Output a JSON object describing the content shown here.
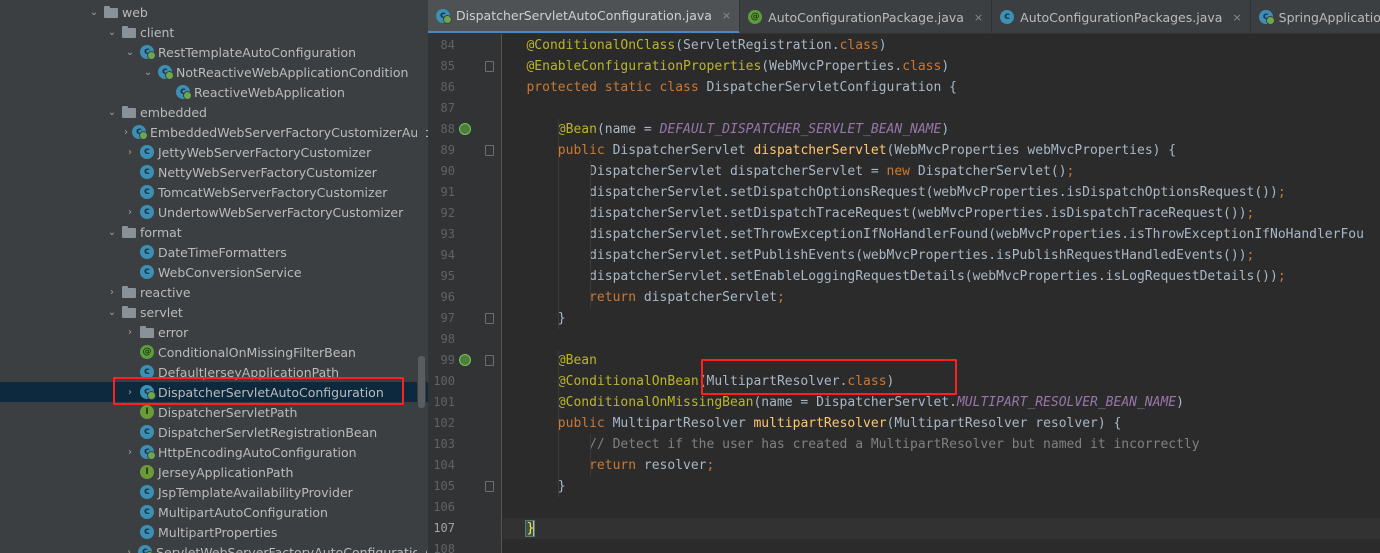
{
  "project_tree": {
    "items": [
      {
        "depth": 5,
        "expander": "open",
        "icon": "folder",
        "label": "web"
      },
      {
        "depth": 6,
        "expander": "open",
        "icon": "folder",
        "label": "client"
      },
      {
        "depth": 7,
        "expander": "open",
        "icon": "class-spring",
        "label": "RestTemplateAutoConfiguration"
      },
      {
        "depth": 8,
        "expander": "open",
        "icon": "class-spring",
        "label": "NotReactiveWebApplicationCondition"
      },
      {
        "depth": 9,
        "expander": "none",
        "icon": "class-spring",
        "label": "ReactiveWebApplication"
      },
      {
        "depth": 6,
        "expander": "open",
        "icon": "folder",
        "label": "embedded"
      },
      {
        "depth": 7,
        "expander": "closed",
        "icon": "class-spring",
        "label": "EmbeddedWebServerFactoryCustomizerAutoC"
      },
      {
        "depth": 7,
        "expander": "closed",
        "icon": "class",
        "label": "JettyWebServerFactoryCustomizer"
      },
      {
        "depth": 7,
        "expander": "none",
        "icon": "class",
        "label": "NettyWebServerFactoryCustomizer"
      },
      {
        "depth": 7,
        "expander": "none",
        "icon": "class",
        "label": "TomcatWebServerFactoryCustomizer"
      },
      {
        "depth": 7,
        "expander": "closed",
        "icon": "class",
        "label": "UndertowWebServerFactoryCustomizer"
      },
      {
        "depth": 6,
        "expander": "open",
        "icon": "folder",
        "label": "format"
      },
      {
        "depth": 7,
        "expander": "none",
        "icon": "class",
        "label": "DateTimeFormatters"
      },
      {
        "depth": 7,
        "expander": "none",
        "icon": "class",
        "label": "WebConversionService"
      },
      {
        "depth": 6,
        "expander": "closed",
        "icon": "folder",
        "label": "reactive"
      },
      {
        "depth": 6,
        "expander": "open",
        "icon": "folder",
        "label": "servlet"
      },
      {
        "depth": 7,
        "expander": "closed",
        "icon": "folder",
        "label": "error"
      },
      {
        "depth": 7,
        "expander": "none",
        "icon": "annotation",
        "label": "ConditionalOnMissingFilterBean"
      },
      {
        "depth": 7,
        "expander": "none",
        "icon": "class",
        "label": "DefaultJerseyApplicationPath"
      },
      {
        "depth": 7,
        "expander": "closed",
        "icon": "class-spring",
        "label": "DispatcherServletAutoConfiguration",
        "selected": true
      },
      {
        "depth": 7,
        "expander": "none",
        "icon": "interface",
        "label": "DispatcherServletPath"
      },
      {
        "depth": 7,
        "expander": "none",
        "icon": "class",
        "label": "DispatcherServletRegistrationBean"
      },
      {
        "depth": 7,
        "expander": "closed",
        "icon": "class-spring",
        "label": "HttpEncodingAutoConfiguration"
      },
      {
        "depth": 7,
        "expander": "none",
        "icon": "interface",
        "label": "JerseyApplicationPath"
      },
      {
        "depth": 7,
        "expander": "none",
        "icon": "class",
        "label": "JspTemplateAvailabilityProvider"
      },
      {
        "depth": 7,
        "expander": "none",
        "icon": "class",
        "label": "MultipartAutoConfiguration"
      },
      {
        "depth": 7,
        "expander": "none",
        "icon": "class",
        "label": "MultipartProperties"
      },
      {
        "depth": 7,
        "expander": "closed",
        "icon": "class-spring",
        "label": "ServletWebServerFactoryAutoConfiguration"
      }
    ]
  },
  "tabs": [
    {
      "label": "DispatcherServletAutoConfiguration.java",
      "icon": "class-spring",
      "active": true,
      "close": "×"
    },
    {
      "label": "AutoConfigurationPackage.java",
      "icon": "annotation",
      "active": false,
      "close": "×"
    },
    {
      "label": "AutoConfigurationPackages.java",
      "icon": "class",
      "active": false,
      "close": "×"
    },
    {
      "label": "SpringApplication.class",
      "icon": "class-spring",
      "active": false,
      "close": "×"
    }
  ],
  "editor": {
    "lines": [
      {
        "n": "84",
        "mark": false,
        "fold": false,
        "indent": 1,
        "tokens": [
          [
            "ann",
            "@ConditionalOnClass"
          ],
          [
            "p",
            "(ServletRegistration."
          ],
          [
            "kw",
            "class"
          ],
          [
            "p",
            ")"
          ]
        ]
      },
      {
        "n": "85",
        "mark": false,
        "fold": true,
        "indent": 1,
        "tokens": [
          [
            "ann",
            "@EnableConfigurationProperties"
          ],
          [
            "p",
            "(WebMvcProperties."
          ],
          [
            "kw",
            "class"
          ],
          [
            "p",
            ")"
          ]
        ]
      },
      {
        "n": "86",
        "mark": false,
        "fold": false,
        "indent": 1,
        "tokens": [
          [
            "kw",
            "protected static class "
          ],
          [
            "p",
            "DispatcherServletConfiguration "
          ],
          [
            "brace",
            "{"
          ]
        ]
      },
      {
        "n": "87",
        "mark": false,
        "fold": false,
        "indent": 0,
        "tokens": []
      },
      {
        "n": "88",
        "mark": true,
        "fold": false,
        "indent": 2,
        "tokens": [
          [
            "ann",
            "@Bean"
          ],
          [
            "p",
            "(name = "
          ],
          [
            "const",
            "DEFAULT_DISPATCHER_SERVLET_BEAN_NAME"
          ],
          [
            "p",
            ")"
          ]
        ]
      },
      {
        "n": "89",
        "mark": false,
        "fold": true,
        "indent": 2,
        "tokens": [
          [
            "kw",
            "public "
          ],
          [
            "p",
            "DispatcherServlet "
          ],
          [
            "fn",
            "dispatcherServlet"
          ],
          [
            "p",
            "(WebMvcProperties webMvcProperties) {"
          ]
        ]
      },
      {
        "n": "90",
        "mark": false,
        "fold": false,
        "indent": 3,
        "tokens": [
          [
            "p",
            "DispatcherServlet dispatcherServlet = "
          ],
          [
            "kw",
            "new "
          ],
          [
            "p",
            "DispatcherServlet()"
          ],
          [
            "kw",
            ";"
          ]
        ]
      },
      {
        "n": "91",
        "mark": false,
        "fold": false,
        "indent": 3,
        "tokens": [
          [
            "p",
            "dispatcherServlet.setDispatchOptionsRequest(webMvcProperties.isDispatchOptionsRequest())"
          ],
          [
            "kw",
            ";"
          ]
        ]
      },
      {
        "n": "92",
        "mark": false,
        "fold": false,
        "indent": 3,
        "tokens": [
          [
            "p",
            "dispatcherServlet.setDispatchTraceRequest(webMvcProperties.isDispatchTraceRequest())"
          ],
          [
            "kw",
            ";"
          ]
        ]
      },
      {
        "n": "93",
        "mark": false,
        "fold": false,
        "indent": 3,
        "tokens": [
          [
            "p",
            "dispatcherServlet.setThrowExceptionIfNoHandlerFound(webMvcProperties.isThrowExceptionIfNoHandlerFou"
          ]
        ]
      },
      {
        "n": "94",
        "mark": false,
        "fold": false,
        "indent": 3,
        "tokens": [
          [
            "p",
            "dispatcherServlet.setPublishEvents(webMvcProperties.isPublishRequestHandledEvents())"
          ],
          [
            "kw",
            ";"
          ]
        ]
      },
      {
        "n": "95",
        "mark": false,
        "fold": false,
        "indent": 3,
        "tokens": [
          [
            "p",
            "dispatcherServlet.setEnableLoggingRequestDetails(webMvcProperties.isLogRequestDetails())"
          ],
          [
            "kw",
            ";"
          ]
        ]
      },
      {
        "n": "96",
        "mark": false,
        "fold": false,
        "indent": 3,
        "tokens": [
          [
            "kw",
            "return "
          ],
          [
            "p",
            "dispatcherServlet"
          ],
          [
            "kw",
            ";"
          ]
        ]
      },
      {
        "n": "97",
        "mark": false,
        "fold": true,
        "indent": 2,
        "tokens": [
          [
            "p",
            "}"
          ]
        ]
      },
      {
        "n": "98",
        "mark": false,
        "fold": false,
        "indent": 0,
        "tokens": []
      },
      {
        "n": "99",
        "mark": true,
        "fold": true,
        "indent": 2,
        "tokens": [
          [
            "ann",
            "@Bean"
          ]
        ]
      },
      {
        "n": "100",
        "mark": false,
        "fold": false,
        "indent": 2,
        "tokens": [
          [
            "ann",
            "@ConditionalOnBean"
          ],
          [
            "p",
            "(MultipartResolver."
          ],
          [
            "kw",
            "class"
          ],
          [
            "p",
            ")"
          ]
        ]
      },
      {
        "n": "101",
        "mark": false,
        "fold": false,
        "indent": 2,
        "tokens": [
          [
            "ann",
            "@ConditionalOnMissingBean"
          ],
          [
            "p",
            "(name = DispatcherServlet."
          ],
          [
            "const",
            "MULTIPART_RESOLVER_BEAN_NAME"
          ],
          [
            "p",
            ")"
          ]
        ]
      },
      {
        "n": "102",
        "mark": false,
        "fold": false,
        "indent": 2,
        "tokens": [
          [
            "kw",
            "public "
          ],
          [
            "p",
            "MultipartResolver "
          ],
          [
            "fn",
            "multipartResolver"
          ],
          [
            "p",
            "(MultipartResolver resolver) {"
          ]
        ]
      },
      {
        "n": "103",
        "mark": false,
        "fold": false,
        "indent": 3,
        "tokens": [
          [
            "cmt",
            "// Detect if the user has created a MultipartResolver but named it incorrectly"
          ]
        ]
      },
      {
        "n": "104",
        "mark": false,
        "fold": false,
        "indent": 3,
        "tokens": [
          [
            "kw",
            "return "
          ],
          [
            "p",
            "resolver"
          ],
          [
            "kw",
            ";"
          ]
        ]
      },
      {
        "n": "105",
        "mark": false,
        "fold": true,
        "indent": 2,
        "tokens": [
          [
            "p",
            "}"
          ]
        ]
      },
      {
        "n": "106",
        "mark": false,
        "fold": false,
        "indent": 0,
        "tokens": []
      },
      {
        "n": "107",
        "mark": false,
        "fold": false,
        "indent": 1,
        "current": true,
        "tokens": [
          [
            "brace",
            "}"
          ]
        ]
      },
      {
        "n": "108",
        "mark": false,
        "fold": false,
        "indent": 0,
        "tokens": []
      }
    ]
  },
  "colors": {
    "highlight_box": "#ff2020",
    "annotation": "#bbb529",
    "keyword": "#cc7832",
    "method": "#ffc66d",
    "constant": "#9876aa",
    "comment": "#808080",
    "text": "#a9b7c6"
  }
}
